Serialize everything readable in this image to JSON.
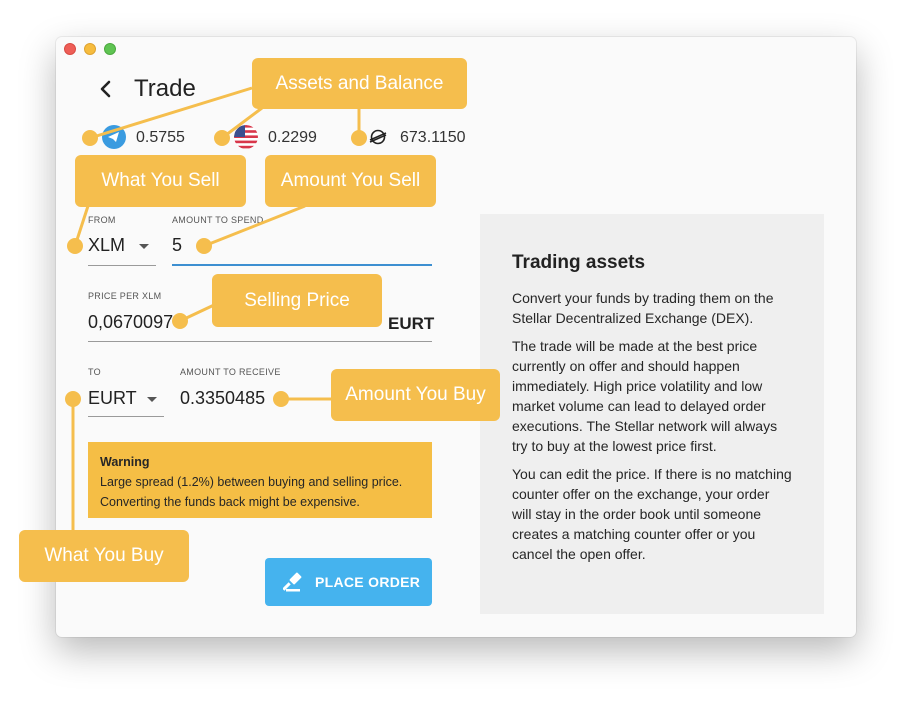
{
  "header": {
    "title": "Trade"
  },
  "balances": [
    {
      "icon": "telegram-coin-icon",
      "value": "0.5755"
    },
    {
      "icon": "us-flag-icon",
      "value": "0.2299"
    },
    {
      "icon": "stellar-icon",
      "value": "673.1150"
    }
  ],
  "sell": {
    "from_label": "FROM",
    "from_value": "XLM",
    "amount_label": "AMOUNT TO SPEND",
    "amount_value": "5"
  },
  "price": {
    "label": "PRICE PER XLM",
    "value": "0,0670097",
    "unit": "EURT"
  },
  "buy": {
    "to_label": "TO",
    "to_value": "EURT",
    "receive_label": "AMOUNT TO RECEIVE",
    "receive_value": "0.3350485"
  },
  "warning": {
    "title": "Warning",
    "line1": "Large spread (1.2%) between buying and selling price.",
    "line2": "Converting the funds back might be expensive."
  },
  "place_order_label": "PLACE ORDER",
  "info": {
    "title": "Trading assets",
    "p1": "Convert your funds by trading them on the Stellar Decentralized Exchange (DEX).",
    "p2": "The trade will be made at the best price currently on offer and should happen immediately. High price volatility and low market volume can lead to delayed order executions. The Stellar network will always try to buy at the lowest price first.",
    "p3": "You can edit the price. If there is no matching counter offer on the exchange, your order will stay in the order book until someone creates a matching counter offer or you cancel the open offer."
  },
  "callouts": {
    "assets": "Assets and Balance",
    "what_sell": "What You Sell",
    "amount_sell": "Amount You Sell",
    "selling_price": "Selling Price",
    "amount_buy": "Amount You Buy",
    "what_buy": "What You Buy"
  },
  "colors": {
    "callout": "#f5be4d",
    "warning_bg": "#f5be45",
    "button": "#45b3ee",
    "active_underline": "#3d8fd1"
  }
}
